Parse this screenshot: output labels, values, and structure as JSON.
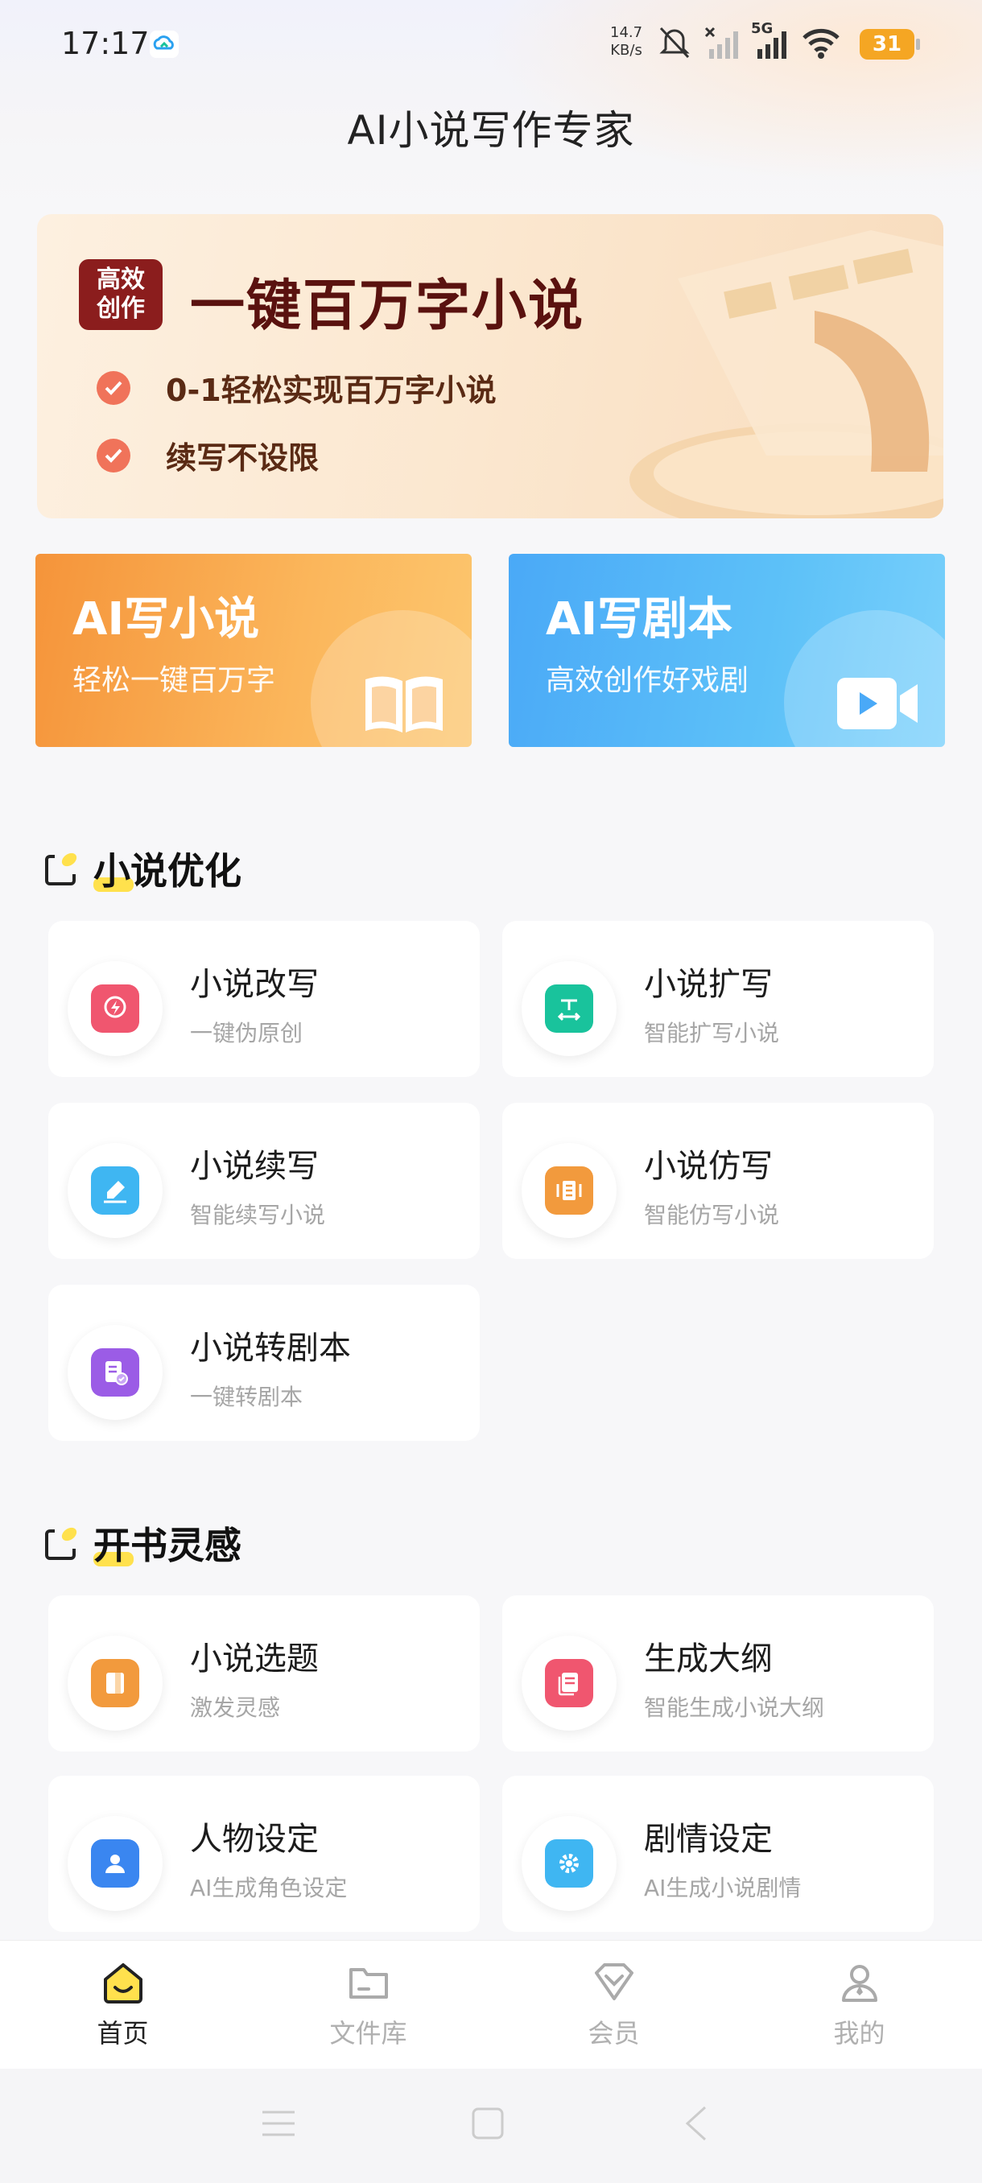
{
  "status_bar": {
    "time": "17:17",
    "speed_value": "14.7",
    "speed_unit": "KB/s",
    "network": "5G",
    "battery": "31"
  },
  "header": {
    "title": "AI小说写作专家"
  },
  "banner": {
    "badge_line1": "高效",
    "badge_line2": "创作",
    "headline": "一键百万字小说",
    "points": [
      "0-1轻松实现百万字小说",
      "续写不设限"
    ]
  },
  "features": [
    {
      "title": "AI写小说",
      "subtitle": "轻松一键百万字",
      "icon": "book-icon"
    },
    {
      "title": "AI写剧本",
      "subtitle": "高效创作好戏剧",
      "icon": "video-icon"
    }
  ],
  "sections": {
    "optimize": {
      "title": "小说优化",
      "items": [
        {
          "name": "小说改写",
          "desc": "一键伪原创",
          "icon": "rewrite-icon",
          "color": "#f0566f"
        },
        {
          "name": "小说扩写",
          "desc": "智能扩写小说",
          "icon": "expand-icon",
          "color": "#19c39c"
        },
        {
          "name": "小说续写",
          "desc": "智能续写小说",
          "icon": "continue-icon",
          "color": "#3fb6f2"
        },
        {
          "name": "小说仿写",
          "desc": "智能仿写小说",
          "icon": "imitate-icon",
          "color": "#f29a3d"
        },
        {
          "name": "小说转剧本",
          "desc": "一键转剧本",
          "icon": "convert-script-icon",
          "color": "#9b5ce6"
        }
      ]
    },
    "inspiration": {
      "title": "开书灵感",
      "items": [
        {
          "name": "小说选题",
          "desc": "激发灵感",
          "icon": "topic-icon",
          "color": "#f29a3d"
        },
        {
          "name": "生成大纲",
          "desc": "智能生成小说大纲",
          "icon": "outline-icon",
          "color": "#f0566f"
        },
        {
          "name": "人物设定",
          "desc": "AI生成角色设定",
          "icon": "character-icon",
          "color": "#3a86f0"
        },
        {
          "name": "剧情设定",
          "desc": "AI生成小说剧情",
          "icon": "plot-icon",
          "color": "#3fb6f2"
        }
      ]
    }
  },
  "bottom_nav": [
    {
      "label": "首页",
      "icon": "home-icon",
      "active": true
    },
    {
      "label": "文件库",
      "icon": "folder-icon",
      "active": false
    },
    {
      "label": "会员",
      "icon": "vip-icon",
      "active": false
    },
    {
      "label": "我的",
      "icon": "profile-icon",
      "active": false
    }
  ],
  "colors": {
    "accent_yellow": "#ffe14d",
    "novel_card": "#f5943a",
    "script_card": "#4aa9f7",
    "banner_text": "#5a120f"
  }
}
